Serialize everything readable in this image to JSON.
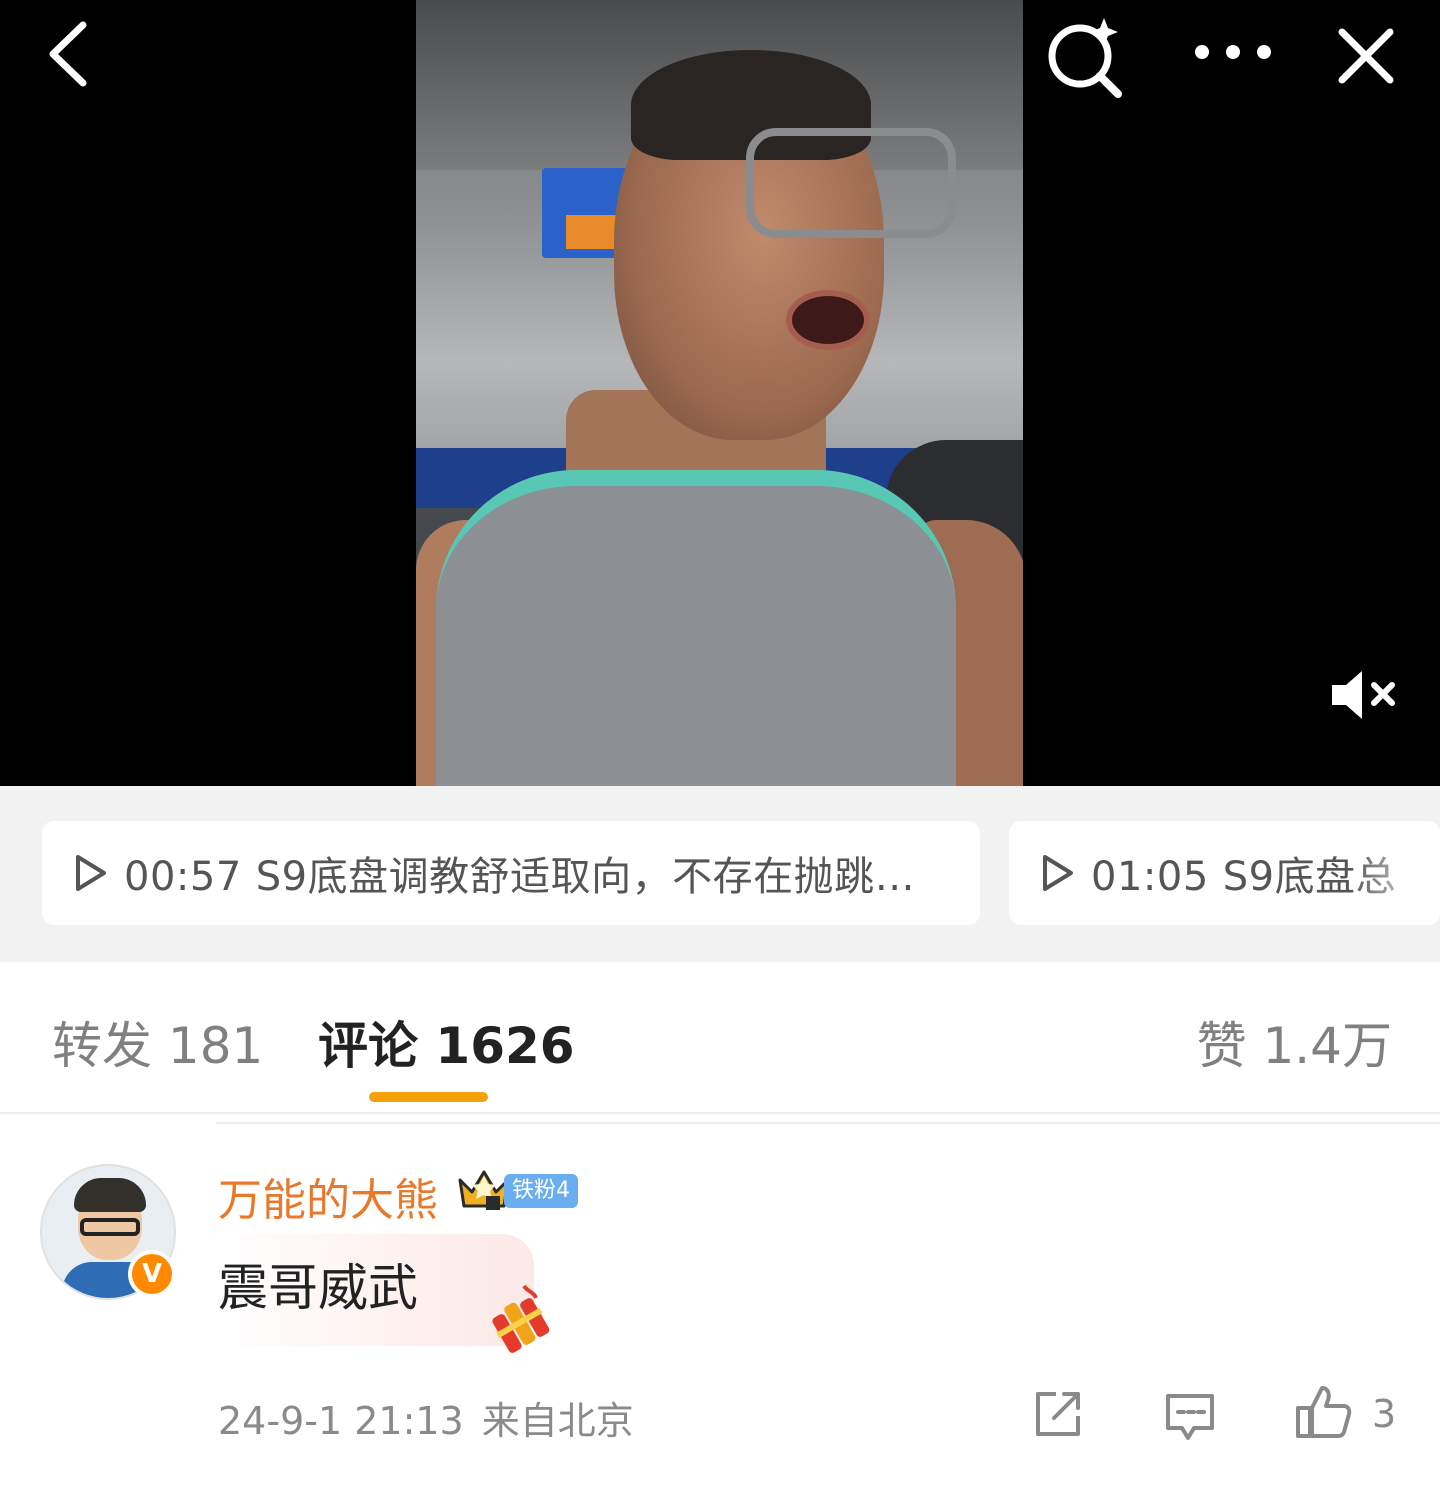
{
  "video": {
    "controls": {
      "back_icon": "chevron-left-icon",
      "search_icon": "search-sparkle-icon",
      "more_icon": "ellipsis-icon",
      "close_icon": "close-icon",
      "mute_icon": "speaker-muted-icon"
    }
  },
  "chapters": [
    {
      "time": "00:57",
      "title": "S9底盘调教舒适取向，不存在抛跳…"
    },
    {
      "time": "01:05",
      "title": "S9底盘总"
    }
  ],
  "tabs": {
    "repost": "转发 181",
    "comment": "评论 1626",
    "like": "赞 1.4万",
    "active_color": "#f5a10a"
  },
  "comment": {
    "username": "万能的大熊",
    "fan_badge": "铁粉4",
    "verified_badge": "V",
    "text": "震哥威武",
    "timestamp": "24-9-1 21:13",
    "location": "来自北京",
    "like_count": "3",
    "username_color": "#e8782a"
  }
}
